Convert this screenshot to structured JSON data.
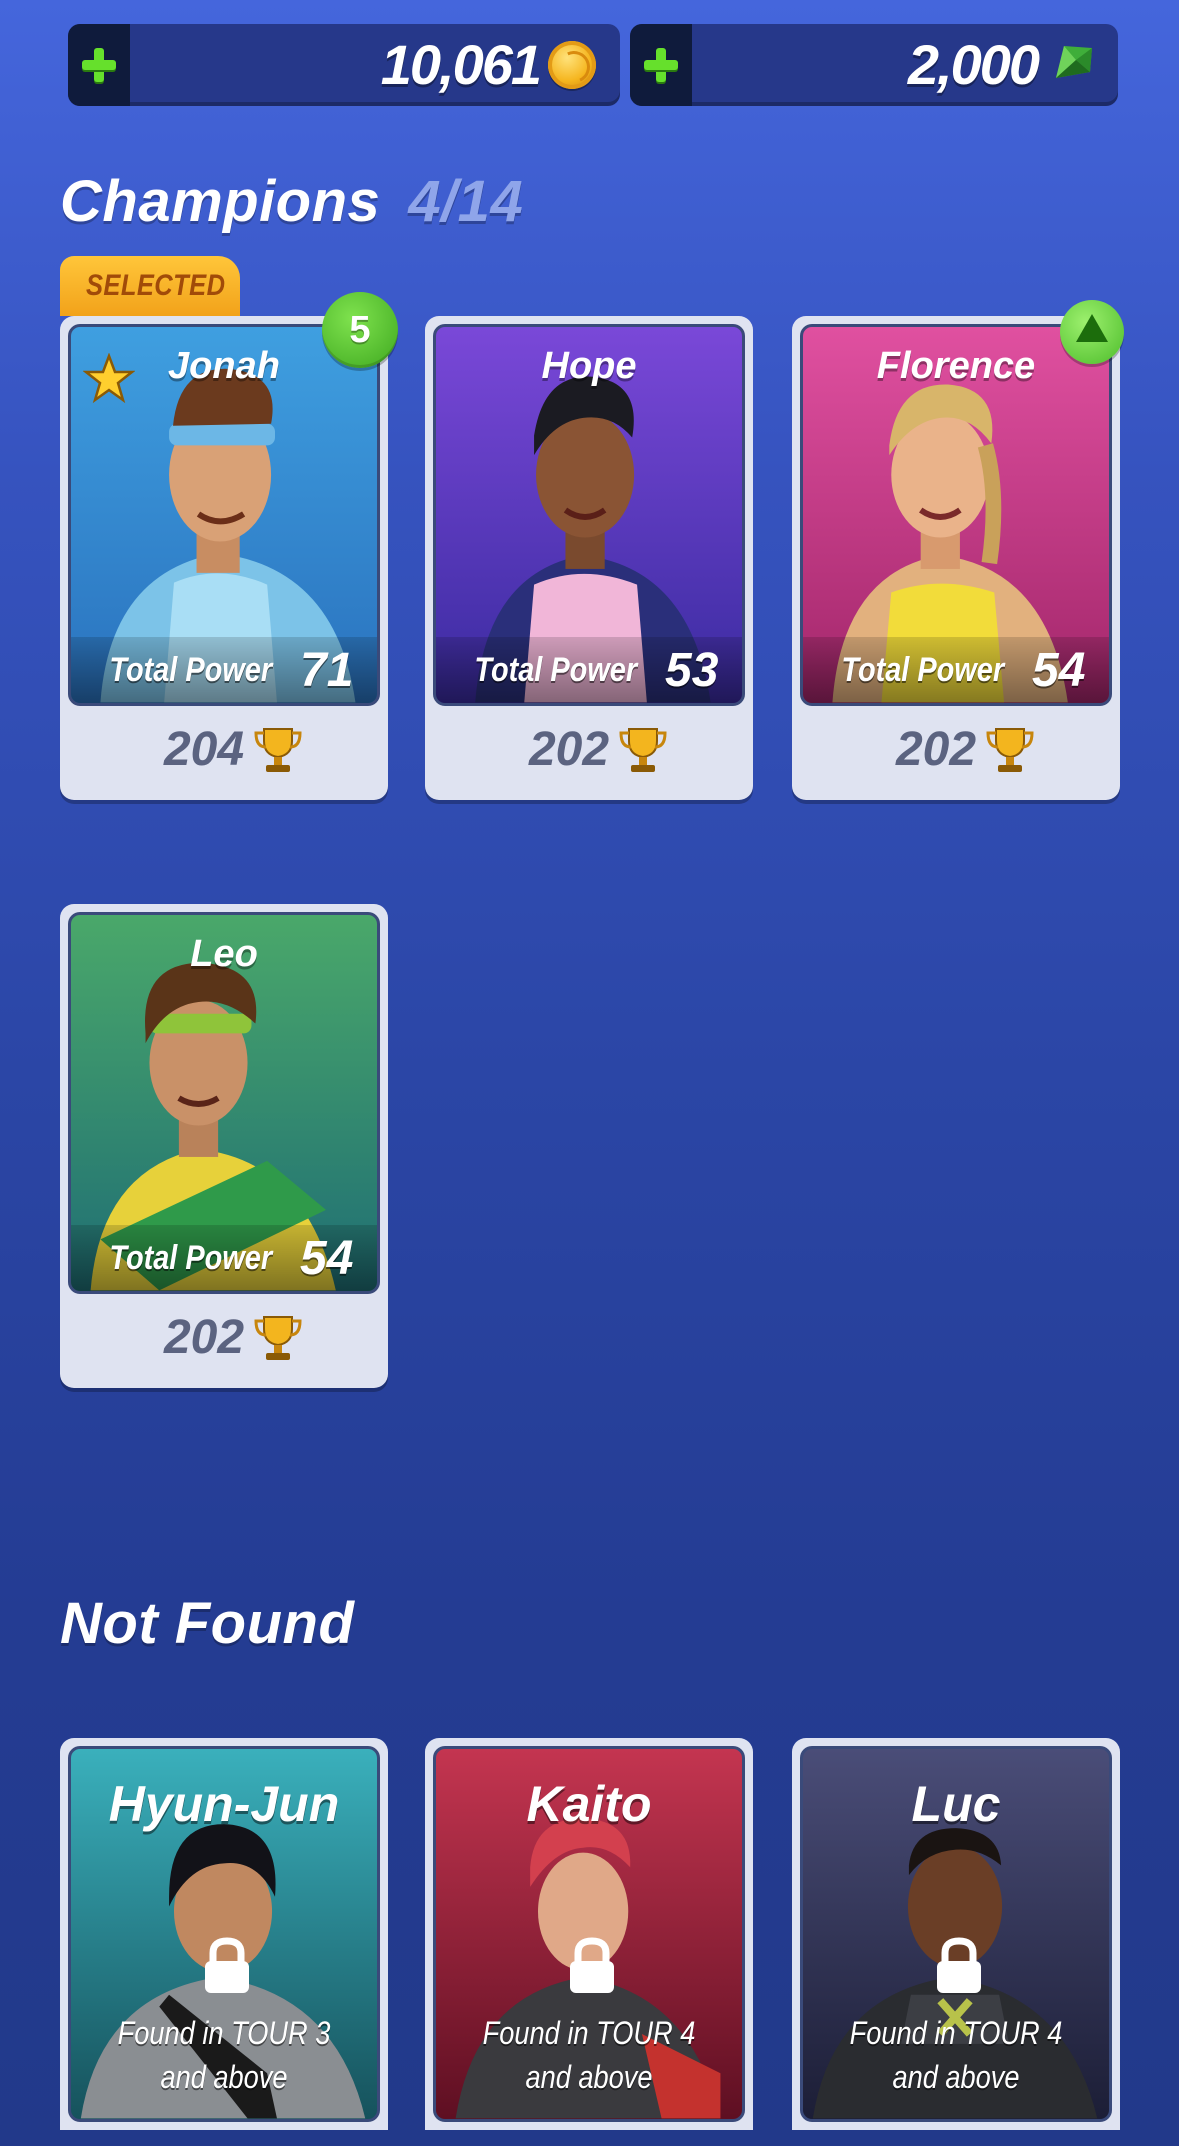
{
  "currency": {
    "coins": "10,061",
    "gems": "2,000",
    "coin_icon": "coin-icon",
    "gem_icon": "gem-icon",
    "plus_icon": "plus-icon"
  },
  "champions_section": {
    "title": "Champions",
    "count": "4/14",
    "selected_label": "SELECTED",
    "power_label": "Total Power",
    "cards": [
      {
        "name": "Jonah",
        "power": "71",
        "trophies": "204",
        "badge": "5",
        "favorite": true,
        "theme": "#3b8fd0"
      },
      {
        "name": "Hope",
        "power": "53",
        "trophies": "202",
        "theme": "#6a3fd0"
      },
      {
        "name": "Florence",
        "power": "54",
        "trophies": "202",
        "badge_icon": "upgrade-arrow-icon",
        "theme": "#d2448f"
      },
      {
        "name": "Leo",
        "power": "54",
        "trophies": "202",
        "theme": "#3a9a62"
      }
    ]
  },
  "not_found_section": {
    "title": "Not Found",
    "cards": [
      {
        "name": "Hyun-Jun",
        "requirement": "Found in TOUR 3 and above",
        "theme": "#2a8a95"
      },
      {
        "name": "Kaito",
        "requirement": "Found in TOUR 4 and above",
        "theme": "#a51f3b"
      },
      {
        "name": "Luc",
        "requirement": "Found in TOUR 4 and above",
        "theme": "#3a3d60"
      }
    ]
  }
}
